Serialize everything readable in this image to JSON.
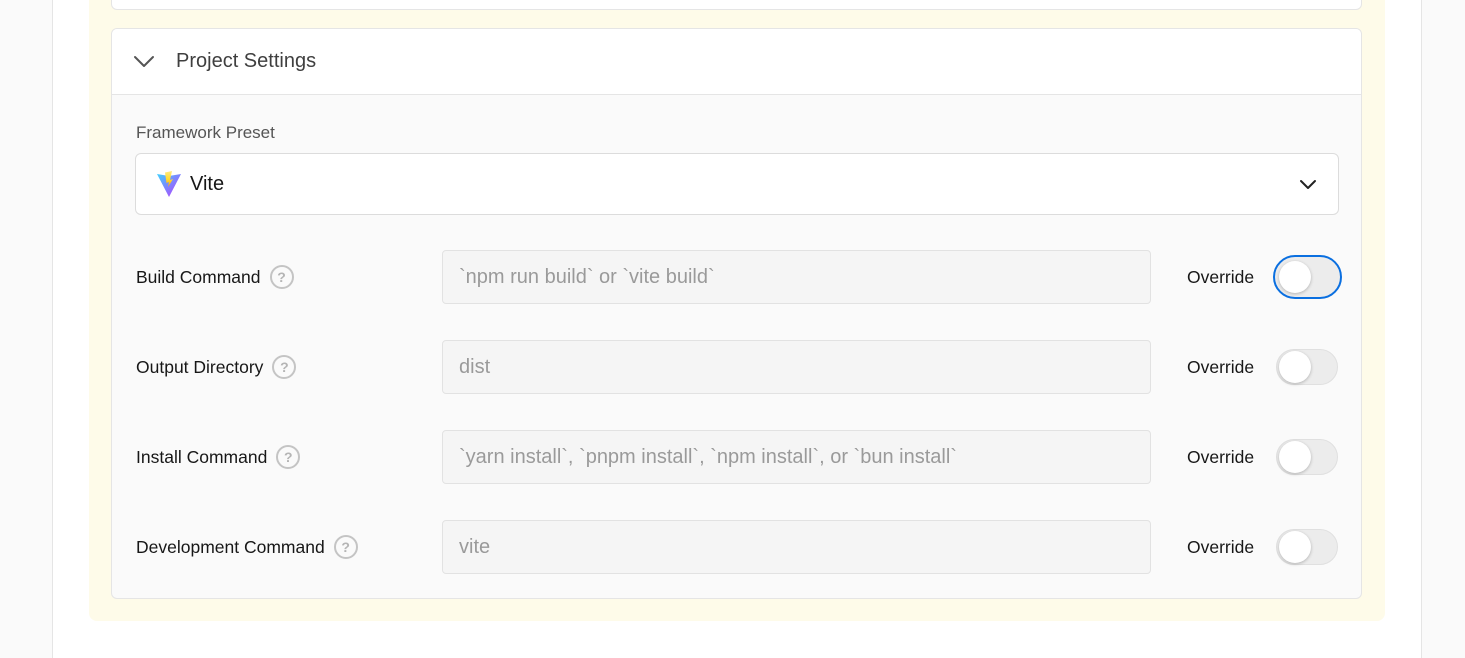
{
  "project_settings": {
    "title": "Project Settings",
    "framework_preset": {
      "label": "Framework Preset",
      "value": "Vite",
      "icon": "vite-logo"
    },
    "rows": [
      {
        "label": "Build Command",
        "placeholder": "`npm run build` or `vite build`",
        "value": "",
        "override_label": "Override",
        "override": false,
        "focused": true
      },
      {
        "label": "Output Directory",
        "placeholder": "dist",
        "value": "",
        "override_label": "Override",
        "override": false
      },
      {
        "label": "Install Command",
        "placeholder": "`yarn install`, `pnpm install`, `npm install`, or `bun install`",
        "value": "",
        "override_label": "Override",
        "override": false
      },
      {
        "label": "Development Command",
        "placeholder": "vite",
        "value": "",
        "override_label": "Override",
        "override": false
      }
    ]
  },
  "help_icon_glyph": "?",
  "colors": {
    "highlight_bg": "#fefbe9",
    "focus_ring": "#0a6fe0"
  }
}
